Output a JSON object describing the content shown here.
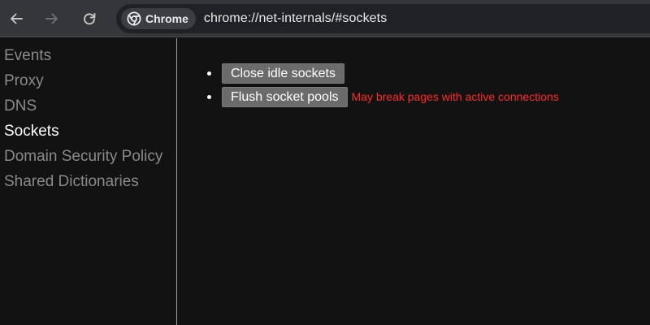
{
  "toolbar": {
    "back_icon": "arrow-left-icon",
    "forward_icon": "arrow-right-icon",
    "reload_icon": "reload-icon",
    "chip_label": "Chrome",
    "chip_icon": "chrome-logo-icon",
    "url": "chrome://net-internals/#sockets"
  },
  "sidebar": {
    "items": [
      {
        "label": "Events",
        "active": false
      },
      {
        "label": "Proxy",
        "active": false
      },
      {
        "label": "DNS",
        "active": false
      },
      {
        "label": "Sockets",
        "active": true
      },
      {
        "label": "Domain Security Policy",
        "active": false
      },
      {
        "label": "Shared Dictionaries",
        "active": false
      }
    ]
  },
  "main": {
    "actions": [
      {
        "button_label": "Close idle sockets",
        "warning": ""
      },
      {
        "button_label": "Flush socket pools",
        "warning": "May break pages with active connections"
      }
    ]
  },
  "colors": {
    "background": "#121212",
    "toolbar": "#35363a",
    "omnibox": "#202124",
    "active_item": "#ffffff",
    "inactive_item": "#8a8a8a",
    "button": "#6b6b6b",
    "warning": "#ff2a2a"
  }
}
